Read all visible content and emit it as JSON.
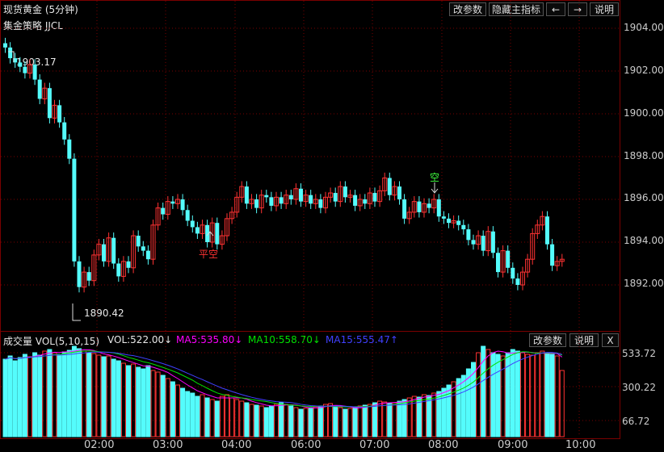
{
  "header": {
    "title": "现货黄金 (5分钟)",
    "strategy": "集金策略 JJCL",
    "btn_params": "改参数",
    "btn_hide": "隐藏主指标",
    "btn_prev": "←",
    "btn_next": "→",
    "btn_help": "说明"
  },
  "price_axis": {
    "labels": [
      "1904.00",
      "1902.00",
      "1900.00",
      "1898.00",
      "1896.00",
      "1894.00",
      "1892.00"
    ]
  },
  "time_axis": {
    "labels": [
      "02:00",
      "03:00",
      "04:00",
      "06:00",
      "07:00",
      "08:00",
      "09:00",
      "10:00"
    ]
  },
  "annotations": {
    "high": "1903.17",
    "low": "1890.42",
    "short_signal": "空",
    "close_short_signal": "平空"
  },
  "volume_panel": {
    "title": "成交量 VOL(5,10,15)",
    "vol": "VOL:522.00↓",
    "ma5": "MA5:535.80↓",
    "ma10": "MA10:558.70↓",
    "ma15": "MA15:555.47↑",
    "btn_params": "改参数",
    "btn_help": "说明",
    "btn_close": "X",
    "axis_labels": [
      "533.72",
      "300.22",
      "66.72"
    ]
  },
  "colors": {
    "up": "#ff3232",
    "down": "#54fcfc",
    "ma5": "#ff00ff",
    "ma10": "#00e000",
    "ma15": "#4040ff",
    "grid": "#7a0000"
  }
}
